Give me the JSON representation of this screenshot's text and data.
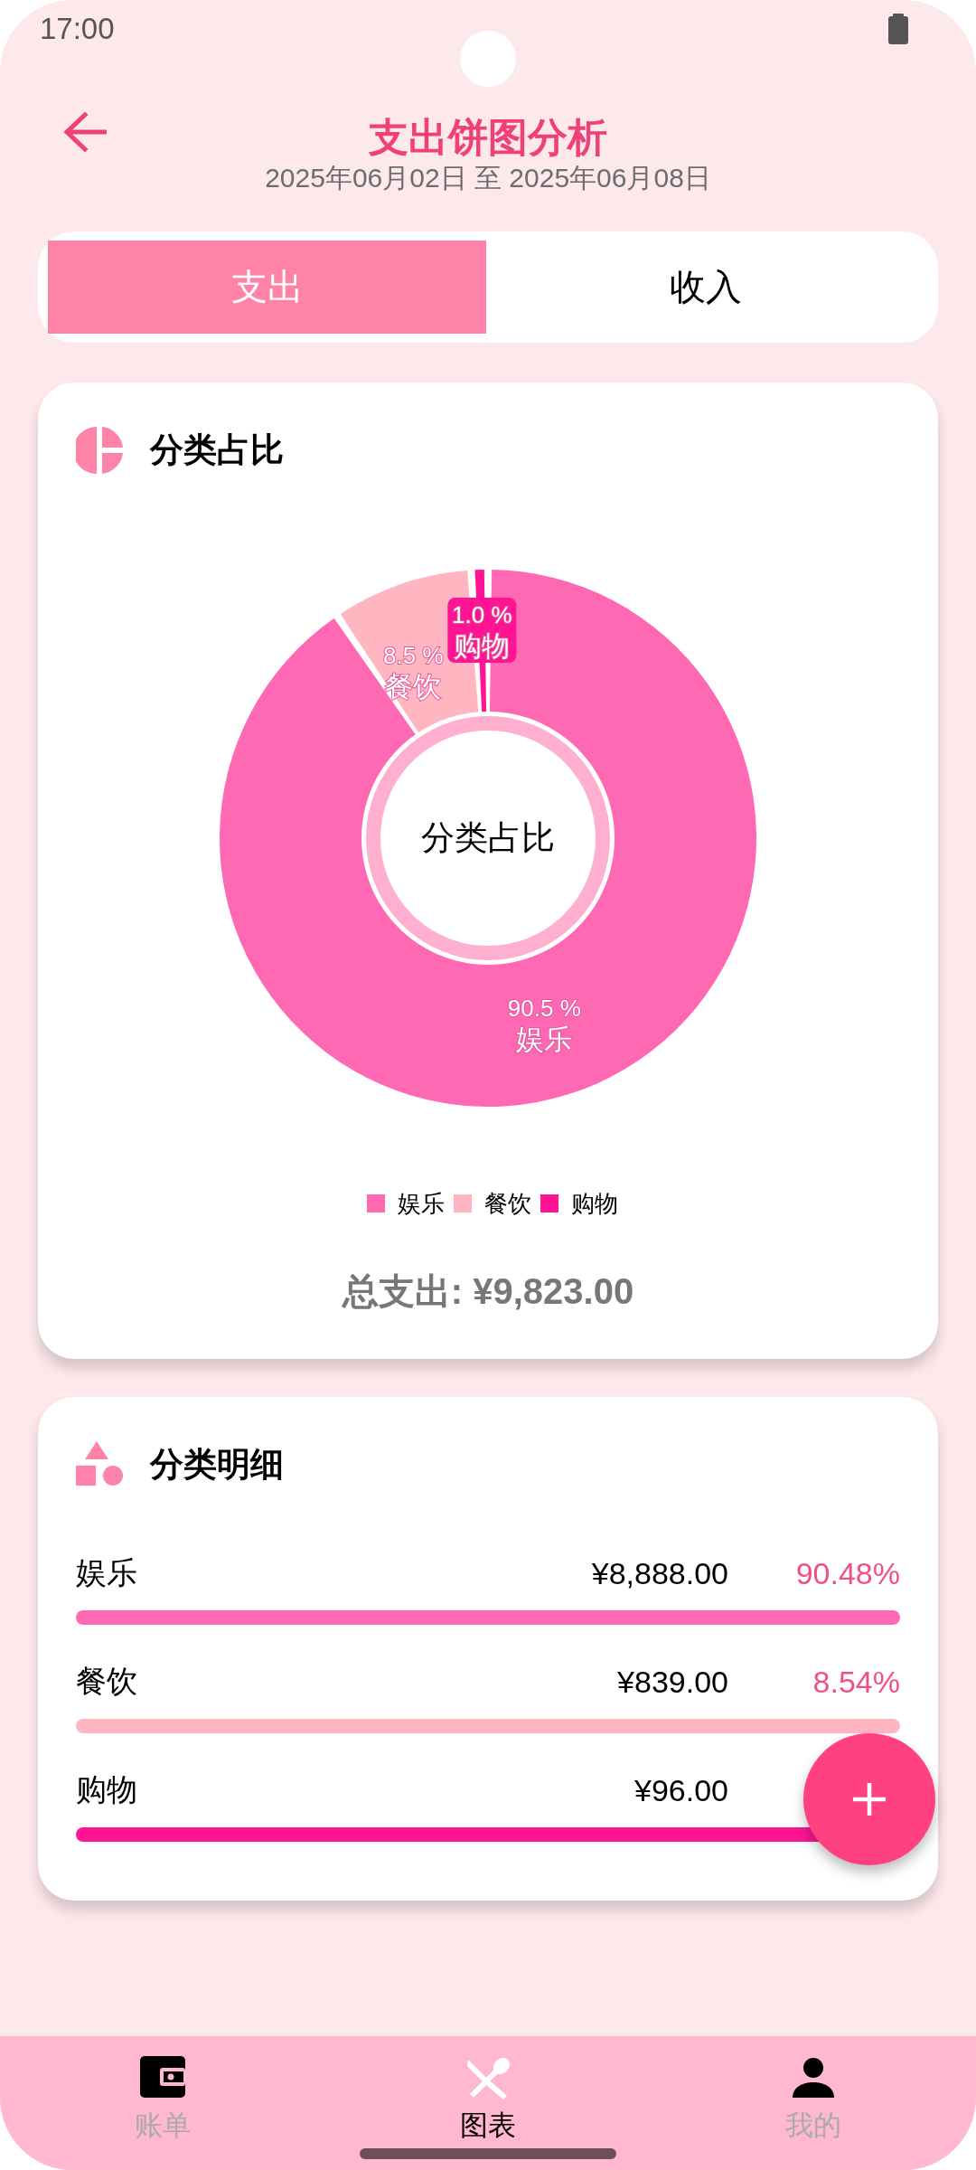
{
  "status_bar": {
    "time": "17:00"
  },
  "header": {
    "title": "支出饼图分析",
    "date_range": "2025年06月02日 至 2025年06月08日"
  },
  "tabs": [
    {
      "label": "支出",
      "selected": true
    },
    {
      "label": "收入",
      "selected": false
    }
  ],
  "pie_card": {
    "title": "分类占比",
    "center_label": "分类占比",
    "chart_data": {
      "type": "donut",
      "categories": [
        "娱乐",
        "餐饮",
        "购物"
      ],
      "values": [
        90.5,
        8.5,
        1.0
      ],
      "value_labels": [
        "90.5 %",
        "8.5 %",
        "1.0 %"
      ]
    },
    "legend": [
      {
        "label": "娱乐",
        "color": "#ff69b4"
      },
      {
        "label": "餐饮",
        "color": "#ffb6c1"
      },
      {
        "label": "购物",
        "color": "#ff1493"
      }
    ],
    "total": "总支出: ¥9,823.00"
  },
  "detail_card": {
    "title": "分类明细",
    "rows": [
      {
        "name": "娱乐",
        "amount": "¥8,888.00",
        "percent": "90.48%",
        "color": "#ff69b4"
      },
      {
        "name": "餐饮",
        "amount": "¥839.00",
        "percent": "8.54%",
        "color": "#ffb6c1"
      },
      {
        "name": "购物",
        "amount": "¥96.00",
        "color": "#ff1493"
      }
    ]
  },
  "bottom_nav": [
    {
      "kind": "wallet",
      "label": "账单",
      "selected": false
    },
    {
      "kind": "cutlery",
      "label": "图表",
      "selected": true
    },
    {
      "kind": "person",
      "label": "我的",
      "selected": false
    }
  ]
}
